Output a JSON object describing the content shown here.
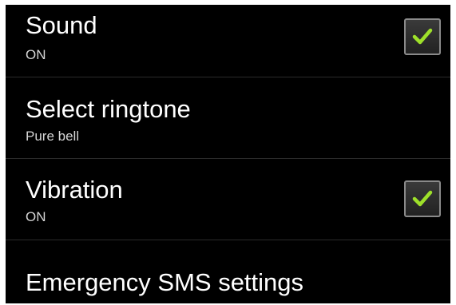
{
  "settings": {
    "sound": {
      "title": "Sound",
      "summary": "ON",
      "checked": true
    },
    "ringtone": {
      "title": "Select ringtone",
      "summary": "Pure bell"
    },
    "vibration": {
      "title": "Vibration",
      "summary": "ON",
      "checked": true
    },
    "emergency_sms": {
      "title": "Emergency SMS settings"
    }
  },
  "colors": {
    "check_mark": "#9ee02a",
    "background": "#000000"
  },
  "icons": {
    "checkbox_checked": "checkmark-icon"
  }
}
